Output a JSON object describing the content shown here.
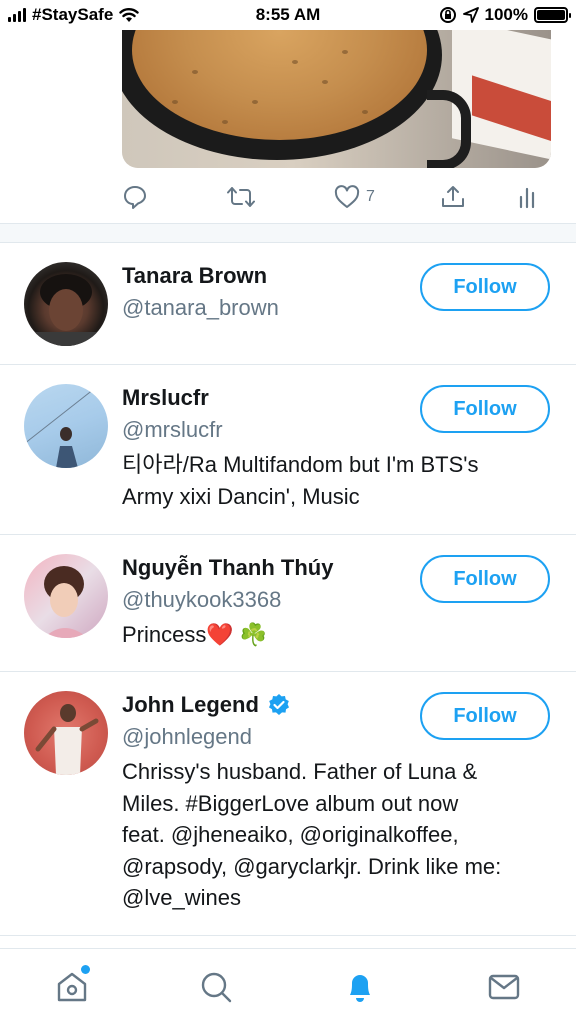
{
  "status_bar": {
    "carrier": "#StaySafe",
    "time": "8:55 AM",
    "battery": "100%",
    "battery_level": 1.0
  },
  "tweet": {
    "like_count": "7"
  },
  "users": [
    {
      "name": "Tanara Brown",
      "handle": "@tanara_brown",
      "bio": [],
      "follow_label": "Follow",
      "verified": false
    },
    {
      "name": "Mrslucfr",
      "handle": "@mrslucfr",
      "bio": [
        "티아라/Ra Multifandom but I'm BTS's",
        "Army xixi Dancin', Music"
      ],
      "follow_label": "Follow",
      "verified": false
    },
    {
      "name": "Nguyễn Thanh Thúy",
      "handle": "@thuykook3368",
      "bio": [
        "Princess❤️ ☘️"
      ],
      "follow_label": "Follow",
      "verified": false
    },
    {
      "name": "John Legend",
      "handle": "@johnlegend",
      "bio": [
        "Chrissy's husband. Father of Luna &",
        "Miles. #BiggerLove album out now",
        "feat. @jheneaiko, @originalkoffee,",
        "@rapsody, @garyclarkjr. Drink like me:",
        "@lve_wines"
      ],
      "follow_label": "Follow",
      "verified": true
    }
  ],
  "colors": {
    "accent": "#1da1f2",
    "secondary_text": "#657786",
    "divider": "#e1e8ed"
  },
  "tabs": [
    "home-icon",
    "search-icon",
    "notifications-icon",
    "messages-icon"
  ]
}
